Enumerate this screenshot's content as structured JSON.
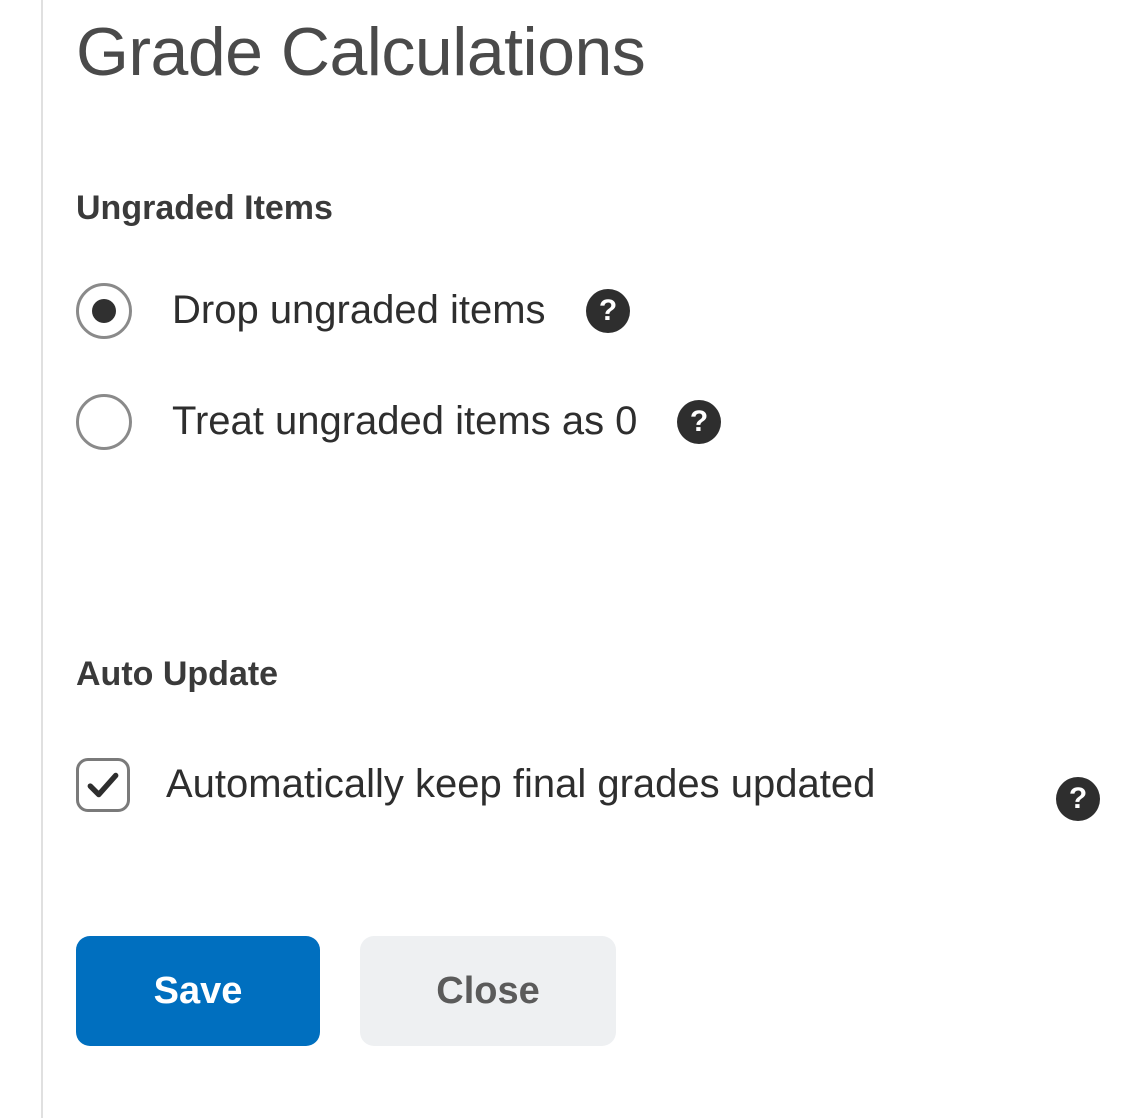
{
  "title": "Grade Calculations",
  "sections": {
    "ungraded": {
      "label": "Ungraded Items",
      "options": {
        "drop": {
          "label": "Drop ungraded items",
          "selected": true
        },
        "zero": {
          "label": "Treat ungraded items as 0",
          "selected": false
        }
      }
    },
    "autoupdate": {
      "label": "Auto Update",
      "checkbox": {
        "label": "Automatically keep final grades updated",
        "checked": true
      }
    }
  },
  "buttons": {
    "save": "Save",
    "close": "Close"
  },
  "colors": {
    "primary": "#006fbf",
    "secondary_bg": "#eef0f2",
    "text": "#2e2e2e"
  }
}
